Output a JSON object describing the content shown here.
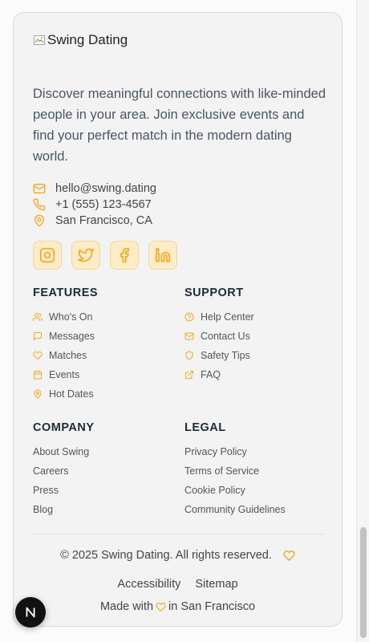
{
  "brand": {
    "logo_alt": "Swing Dating"
  },
  "description": "Discover meaningful connections with like-minded people in your area. Join exclusive events and find your perfect match in the modern dating world.",
  "contact": {
    "email": "hello@swing.dating",
    "phone": "+1 (555) 123-4567",
    "location": "San Francisco, CA"
  },
  "social": [
    "instagram-icon",
    "twitter-icon",
    "facebook-icon",
    "linkedin-icon"
  ],
  "features": {
    "title": "FEATURES",
    "items": [
      "Who's On",
      "Messages",
      "Matches",
      "Events",
      "Hot Dates"
    ]
  },
  "support": {
    "title": "SUPPORT",
    "items": [
      "Help Center",
      "Contact Us",
      "Safety Tips",
      "FAQ"
    ]
  },
  "company": {
    "title": "COMPANY",
    "items": [
      "About Swing",
      "Careers",
      "Press",
      "Blog"
    ]
  },
  "legal": {
    "title": "LEGAL",
    "items": [
      "Privacy Policy",
      "Terms of Service",
      "Cookie Policy",
      "Community Guidelines"
    ]
  },
  "footer": {
    "copyright": "© 2025 Swing Dating. All rights reserved.",
    "accessibility": "Accessibility",
    "sitemap": "Sitemap",
    "made_with_prefix": "Made with",
    "made_with_suffix": "in San Francisco"
  },
  "colors": {
    "accent": "#f0a81e",
    "card_bg": "#f3f3f3",
    "social_bg": "#fcecc8"
  },
  "badge": {
    "letter": "N"
  }
}
